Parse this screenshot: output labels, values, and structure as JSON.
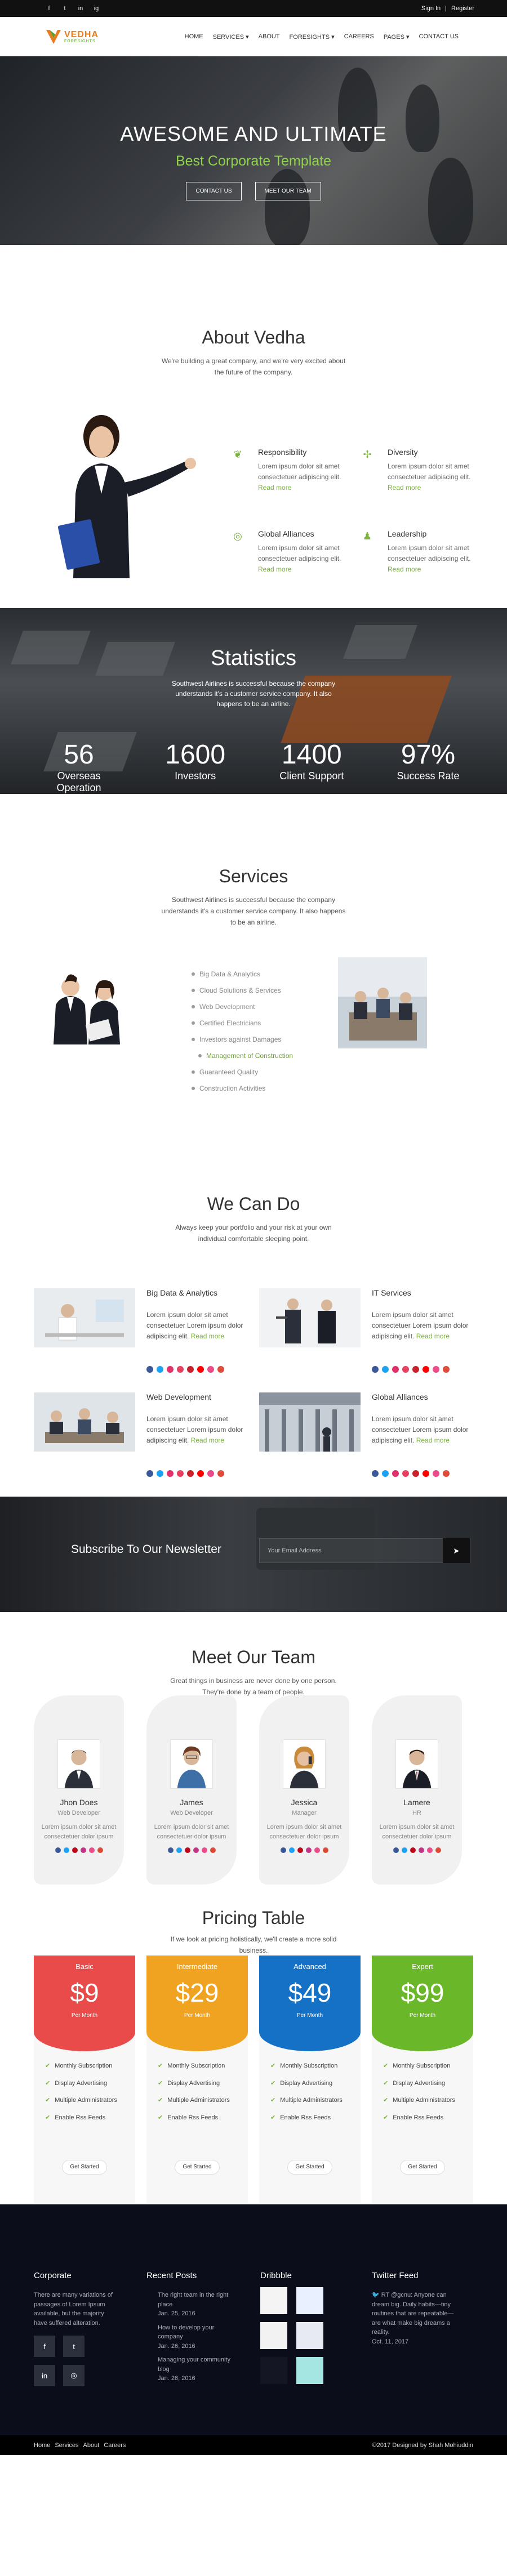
{
  "topbar": {
    "social": [
      "f",
      "t",
      "in",
      "ig"
    ],
    "sign_in": "Sign In",
    "divider": "|",
    "register": "Register"
  },
  "brand": {
    "name": "VEDHA",
    "tagline": "FORESIGHTS",
    "accent": "#e87c1e",
    "green": "#5aa02c"
  },
  "nav": [
    "HOME",
    "SERVICES ▾",
    "ABOUT",
    "FORESIGHTS ▾",
    "CAREERS",
    "PAGES ▾",
    "CONTACT US"
  ],
  "hero": {
    "title": "AWESOME AND ULTIMATE",
    "subtitle": "Best Corporate Template",
    "btn1": "CONTACT US",
    "btn2": "MEET OUR TEAM"
  },
  "about": {
    "title": "About Vedha",
    "sub": "We're building a great company, and we're very excited about the future of the company.",
    "features": [
      {
        "icon": "leaf-icon",
        "title": "Responsibility",
        "text": "Lorem ipsum dolor sit amet consectetuer adipiscing elit.",
        "more": "Read more"
      },
      {
        "icon": "diversity-icon",
        "title": "Diversity",
        "text": "Lorem ipsum dolor sit amet consectetuer adipiscing elit.",
        "more": "Read more"
      },
      {
        "icon": "globe-icon",
        "title": "Global Alliances",
        "text": "Lorem ipsum dolor sit amet consectetuer adipiscing elit.",
        "more": "Read more"
      },
      {
        "icon": "leadership-icon",
        "title": "Leadership",
        "text": "Lorem ipsum dolor sit amet consectetuer adipiscing elit.",
        "more": "Read more"
      }
    ]
  },
  "stats": {
    "title": "Statistics",
    "sub": "Southwest Airlines is successful because the company understands it's a customer service company. It also happens to be an airline.",
    "items": [
      {
        "n": "56",
        "l": "Overseas Operation"
      },
      {
        "n": "1600",
        "l": "Investors"
      },
      {
        "n": "1400",
        "l": "Client Support"
      },
      {
        "n": "97%",
        "l": "Success Rate"
      }
    ]
  },
  "services": {
    "title": "Services",
    "sub": "Southwest Airlines is successful because the company understands it's a customer service company. It also happens to be an airline.",
    "items": [
      "Big Data & Analytics",
      "Cloud Solutions & Services",
      "Web Development",
      "Certified Electricians",
      "Investors against Damages",
      "Management of Construction",
      "Guaranteed Quality",
      "Construction Activities"
    ]
  },
  "wecando": {
    "title": "We Can Do",
    "sub": "Always keep your portfolio and your risk at your own individual comfortable sleeping point.",
    "cards": [
      {
        "title": "Big Data & Analytics",
        "text": "Lorem ipsum dolor sit amet consectetuer Lorem ipsum dolor adipiscing elit.",
        "more": "Read more"
      },
      {
        "title": "IT Services",
        "text": "Lorem ipsum dolor sit amet consectetuer Lorem ipsum dolor adipiscing elit.",
        "more": "Read more"
      },
      {
        "title": "Web Development",
        "text": "Lorem ipsum dolor sit amet consectetuer Lorem ipsum dolor adipiscing elit.",
        "more": "Read more"
      },
      {
        "title": "Global Alliances",
        "text": "Lorem ipsum dolor sit amet consectetuer Lorem ipsum dolor adipiscing elit.",
        "more": "Read more"
      }
    ],
    "icon_colors": [
      "#3b5998",
      "#1da1f2",
      "#e1306c",
      "#e4405f",
      "#c8232c",
      "#ff0000",
      "#ea4c89",
      "#dd4b39"
    ]
  },
  "newsletter": {
    "title": "Subscribe To Our Newsletter",
    "placeholder": "Your Email Address",
    "btn": "➤"
  },
  "team": {
    "title": "Meet Our Team",
    "sub": "Great things in business are never done by one person. They're done by a team of people.",
    "members": [
      {
        "name": "Jhon Does",
        "role": "Web Developer",
        "desc": "Lorem ipsum dolor sit amet consectetuer dolor ipsum"
      },
      {
        "name": "James",
        "role": "Web Developer",
        "desc": "Lorem ipsum dolor sit amet consectetuer dolor ipsum"
      },
      {
        "name": "Jessica",
        "role": "Manager",
        "desc": "Lorem ipsum dolor sit amet consectetuer dolor ipsum"
      },
      {
        "name": "Lamere",
        "role": "HR",
        "desc": "Lorem ipsum dolor sit amet consectetuer dolor ipsum"
      }
    ],
    "icon_colors": [
      "#3b5998",
      "#1da1f2",
      "#bd081c",
      "#c13584",
      "#ea4c89",
      "#dd4b39"
    ]
  },
  "pricing": {
    "title": "Pricing Table",
    "sub": "If we look at pricing holistically, we'll create a more solid business.",
    "plans": [
      {
        "name": "Basic",
        "price": "$9",
        "per": "Per Month",
        "color": "#e94a4a"
      },
      {
        "name": "Intermediate",
        "price": "$29",
        "per": "Per Month",
        "color": "#f0a321"
      },
      {
        "name": "Advanced",
        "price": "$49",
        "per": "Per Month",
        "color": "#1571c6"
      },
      {
        "name": "Expert",
        "price": "$99",
        "per": "Per Month",
        "color": "#6ab72a"
      }
    ],
    "features": [
      "Monthly Subscription",
      "Display Advertising",
      "Multiple Administrators",
      "Enable Rss Feeds"
    ],
    "btn": "Get Started"
  },
  "footer": {
    "corporate": {
      "title": "Corporate",
      "text": "There are many variations of passages of Lorem Ipsum available, but the majority have suffered alteration."
    },
    "posts": {
      "title": "Recent Posts",
      "items": [
        {
          "t": "The right team in the right place",
          "d": "Jan. 25, 2016"
        },
        {
          "t": "How to develop your company",
          "d": "Jan. 26, 2016"
        },
        {
          "t": "Managing your community blog",
          "d": "Jan. 26, 2016"
        }
      ]
    },
    "dribbble": {
      "title": "Dribbble"
    },
    "twitter": {
      "title": "Twitter Feed",
      "text": "RT @gcnu: Anyone can dream big. Daily habits—tiny routines that are repeatable—are what make big dreams a reality.",
      "date": "Oct. 11, 2017"
    },
    "links": [
      "Home",
      "Services",
      "About",
      "Careers"
    ],
    "copy": "©2017 Designed by Shah Mohiuddin"
  }
}
